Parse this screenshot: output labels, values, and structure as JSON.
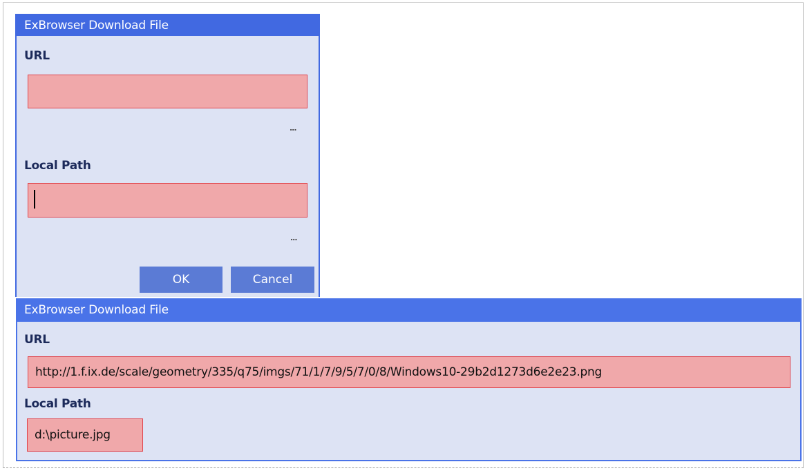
{
  "dialog_top": {
    "title": "ExBrowser Download File",
    "url_label": "URL",
    "url_value": "",
    "url_browse": "...",
    "local_path_label": "Local Path",
    "local_path_value": "",
    "local_path_browse": "...",
    "ok_label": "OK",
    "cancel_label": "Cancel"
  },
  "dialog_bottom": {
    "title": "ExBrowser Download File",
    "url_label": "URL",
    "url_value": "http://1.f.ix.de/scale/geometry/335/q75/imgs/71/1/7/9/5/7/0/8/Windows10-29b2d1273d6e2e23.png",
    "local_path_label": "Local Path",
    "local_path_value": "d:\\picture.jpg"
  },
  "colors": {
    "title_bar": "#4169e1",
    "dialog_bg": "#dde3f4",
    "input_bg": "#f0a8aa",
    "input_border": "#e0444c",
    "button_bg": "#5b7bd5"
  },
  "icons": {
    "browse": "ellipsis-icon"
  }
}
